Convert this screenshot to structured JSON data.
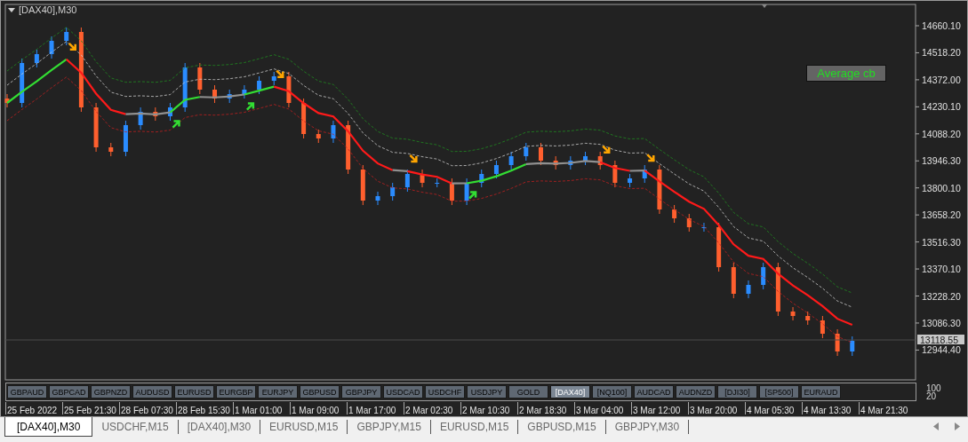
{
  "chart_window": {
    "title": "[DAX40],M30",
    "label_button": "Average cb",
    "current_price": "13118.55",
    "price_axis": [
      "14660.10",
      "14518.20",
      "14372.00",
      "14230.10",
      "14088.20",
      "13946.30",
      "13800.10",
      "13658.20",
      "13516.30",
      "13370.10",
      "13228.20",
      "13086.30",
      "12944.40"
    ],
    "time_axis": [
      "25 Feb 2022",
      "25 Feb 21:30",
      "28 Feb 07:30",
      "28 Feb 15:30",
      "1 Mar 01:00",
      "1 Mar 09:00",
      "1 Mar 17:00",
      "2 Mar 02:30",
      "2 Mar 10:30",
      "2 Mar 18:30",
      "3 Mar 04:00",
      "3 Mar 12:00",
      "3 Mar 20:00",
      "4 Mar 05:30",
      "4 Mar 13:30",
      "4 Mar 21:30"
    ]
  },
  "indicator_window": {
    "scale_labels": [
      "100",
      "20"
    ],
    "buttons": [
      {
        "label": "GBPAUD",
        "selected": false
      },
      {
        "label": "GBPCAD",
        "selected": false
      },
      {
        "label": "GBPNZD",
        "selected": false
      },
      {
        "label": "AUDUSD",
        "selected": false
      },
      {
        "label": "EURUSD",
        "selected": false
      },
      {
        "label": "EURGBP",
        "selected": false
      },
      {
        "label": "EURJPY",
        "selected": false
      },
      {
        "label": "GBPUSD",
        "selected": false
      },
      {
        "label": "GBPJPY",
        "selected": false
      },
      {
        "label": "USDCAD",
        "selected": false
      },
      {
        "label": "USDCHF",
        "selected": false
      },
      {
        "label": "USDJPY",
        "selected": false
      },
      {
        "label": "GOLD",
        "selected": false
      },
      {
        "label": "[DAX40]",
        "selected": true
      },
      {
        "label": "[NQ100]",
        "selected": false
      },
      {
        "label": "AUDCAD",
        "selected": false
      },
      {
        "label": "AUDNZD",
        "selected": false
      },
      {
        "label": "[DJI30]",
        "selected": false
      },
      {
        "label": "[SP500]",
        "selected": false
      },
      {
        "label": "EURAUD",
        "selected": false
      }
    ]
  },
  "tabs": [
    {
      "label": "[DAX40],M30",
      "selected": true
    },
    {
      "label": "USDCHF,M15",
      "selected": false
    },
    {
      "label": "[DAX40],M30",
      "selected": false
    },
    {
      "label": "EURUSD,M15",
      "selected": false
    },
    {
      "label": "GBPJPY,M15",
      "selected": false
    },
    {
      "label": "EURUSD,M15",
      "selected": false
    },
    {
      "label": "GBPUSD,M15",
      "selected": false
    },
    {
      "label": "GBPJPY,M30",
      "selected": false
    }
  ]
}
